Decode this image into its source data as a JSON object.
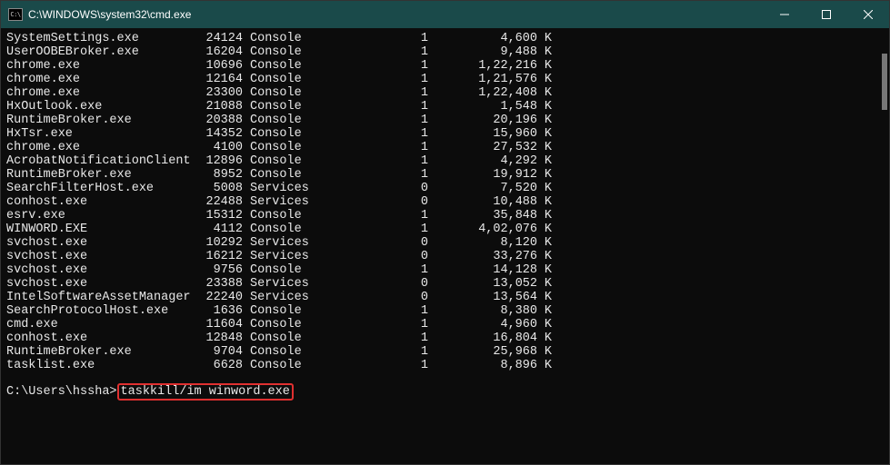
{
  "window": {
    "title": "C:\\WINDOWS\\system32\\cmd.exe"
  },
  "processes": [
    {
      "name": "SystemSettings.exe",
      "pid": "24124",
      "session": "Console",
      "sessnum": "1",
      "mem": "4,600",
      "unit": "K"
    },
    {
      "name": "UserOOBEBroker.exe",
      "pid": "16204",
      "session": "Console",
      "sessnum": "1",
      "mem": "9,488",
      "unit": "K"
    },
    {
      "name": "chrome.exe",
      "pid": "10696",
      "session": "Console",
      "sessnum": "1",
      "mem": "1,22,216",
      "unit": "K"
    },
    {
      "name": "chrome.exe",
      "pid": "12164",
      "session": "Console",
      "sessnum": "1",
      "mem": "1,21,576",
      "unit": "K"
    },
    {
      "name": "chrome.exe",
      "pid": "23300",
      "session": "Console",
      "sessnum": "1",
      "mem": "1,22,408",
      "unit": "K"
    },
    {
      "name": "HxOutlook.exe",
      "pid": "21088",
      "session": "Console",
      "sessnum": "1",
      "mem": "1,548",
      "unit": "K"
    },
    {
      "name": "RuntimeBroker.exe",
      "pid": "20388",
      "session": "Console",
      "sessnum": "1",
      "mem": "20,196",
      "unit": "K"
    },
    {
      "name": "HxTsr.exe",
      "pid": "14352",
      "session": "Console",
      "sessnum": "1",
      "mem": "15,960",
      "unit": "K"
    },
    {
      "name": "chrome.exe",
      "pid": "4100",
      "session": "Console",
      "sessnum": "1",
      "mem": "27,532",
      "unit": "K"
    },
    {
      "name": "AcrobatNotificationClient",
      "pid": "12896",
      "session": "Console",
      "sessnum": "1",
      "mem": "4,292",
      "unit": "K"
    },
    {
      "name": "RuntimeBroker.exe",
      "pid": "8952",
      "session": "Console",
      "sessnum": "1",
      "mem": "19,912",
      "unit": "K"
    },
    {
      "name": "SearchFilterHost.exe",
      "pid": "5008",
      "session": "Services",
      "sessnum": "0",
      "mem": "7,520",
      "unit": "K"
    },
    {
      "name": "conhost.exe",
      "pid": "22488",
      "session": "Services",
      "sessnum": "0",
      "mem": "10,488",
      "unit": "K"
    },
    {
      "name": "esrv.exe",
      "pid": "15312",
      "session": "Console",
      "sessnum": "1",
      "mem": "35,848",
      "unit": "K"
    },
    {
      "name": "WINWORD.EXE",
      "pid": "4112",
      "session": "Console",
      "sessnum": "1",
      "mem": "4,02,076",
      "unit": "K"
    },
    {
      "name": "svchost.exe",
      "pid": "10292",
      "session": "Services",
      "sessnum": "0",
      "mem": "8,120",
      "unit": "K"
    },
    {
      "name": "svchost.exe",
      "pid": "16212",
      "session": "Services",
      "sessnum": "0",
      "mem": "33,276",
      "unit": "K"
    },
    {
      "name": "svchost.exe",
      "pid": "9756",
      "session": "Console",
      "sessnum": "1",
      "mem": "14,128",
      "unit": "K"
    },
    {
      "name": "svchost.exe",
      "pid": "23388",
      "session": "Services",
      "sessnum": "0",
      "mem": "13,052",
      "unit": "K"
    },
    {
      "name": "IntelSoftwareAssetManager",
      "pid": "22240",
      "session": "Services",
      "sessnum": "0",
      "mem": "13,564",
      "unit": "K"
    },
    {
      "name": "SearchProtocolHost.exe",
      "pid": "1636",
      "session": "Console",
      "sessnum": "1",
      "mem": "8,380",
      "unit": "K"
    },
    {
      "name": "cmd.exe",
      "pid": "11604",
      "session": "Console",
      "sessnum": "1",
      "mem": "4,960",
      "unit": "K"
    },
    {
      "name": "conhost.exe",
      "pid": "12848",
      "session": "Console",
      "sessnum": "1",
      "mem": "16,804",
      "unit": "K"
    },
    {
      "name": "RuntimeBroker.exe",
      "pid": "9704",
      "session": "Console",
      "sessnum": "1",
      "mem": "25,968",
      "unit": "K"
    },
    {
      "name": "tasklist.exe",
      "pid": "6628",
      "session": "Console",
      "sessnum": "1",
      "mem": "8,896",
      "unit": "K"
    }
  ],
  "prompt": {
    "path": "C:\\Users\\hssha>",
    "command": "taskkill/im winword.exe"
  }
}
